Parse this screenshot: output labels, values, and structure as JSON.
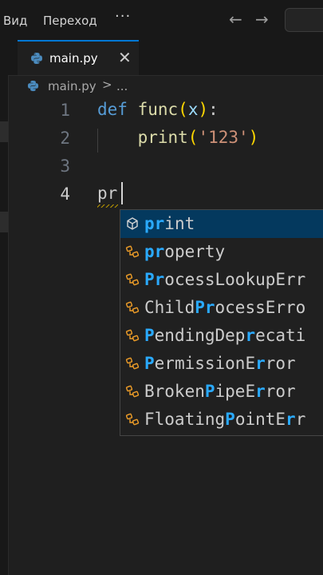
{
  "menu": {
    "items": [
      "Вид",
      "Переход"
    ],
    "more": "···"
  },
  "nav": {
    "back": "←",
    "forward": "→"
  },
  "tab": {
    "label": "main.py",
    "close": "✕"
  },
  "breadcrumb": {
    "file": "main.py",
    "sep": ">",
    "more": "..."
  },
  "editor": {
    "line_numbers": [
      "1",
      "2",
      "3",
      "4"
    ],
    "line1": {
      "kw": "def",
      "sp": " ",
      "fn": "func",
      "open": "(",
      "param": "x",
      "close": ")",
      "colon": ":"
    },
    "line2": {
      "indent": "    ",
      "fn": "print",
      "open": "(",
      "str": "'123'",
      "close": ")"
    },
    "line4": {
      "text": "pr"
    }
  },
  "suggestions": [
    {
      "pre": "",
      "hl1": "pr",
      "mid": "int",
      "hl2": "",
      "post": "",
      "kind": "method"
    },
    {
      "pre": "",
      "hl1": "pr",
      "mid": "operty",
      "hl2": "",
      "post": "",
      "kind": "class"
    },
    {
      "pre": "",
      "hl1": "Pr",
      "mid": "ocessLookupErr",
      "hl2": "",
      "post": "",
      "kind": "class"
    },
    {
      "pre": "Child",
      "hl1": "Pr",
      "mid": "ocessErro",
      "hl2": "",
      "post": "",
      "kind": "class"
    },
    {
      "pre": "",
      "hl1": "P",
      "mid": "endingDep",
      "hl2": "r",
      "post": "ecati",
      "kind": "class"
    },
    {
      "pre": "",
      "hl1": "P",
      "mid": "ermissionE",
      "hl2": "r",
      "post": "ror",
      "kind": "class"
    },
    {
      "pre": "Broken",
      "hl1": "P",
      "mid": "ipeE",
      "hl2": "r",
      "post": "ror",
      "kind": "class"
    },
    {
      "pre": "Floating",
      "hl1": "P",
      "mid": "ointE",
      "hl2": "r",
      "post": "r",
      "kind": "class"
    }
  ],
  "colors": {
    "accent": "#0078d4",
    "highlight": "#2aaaff",
    "selected_bg": "#04395e",
    "keyword": "#569cd6",
    "function": "#dcdcaa",
    "string": "#ce9178"
  }
}
